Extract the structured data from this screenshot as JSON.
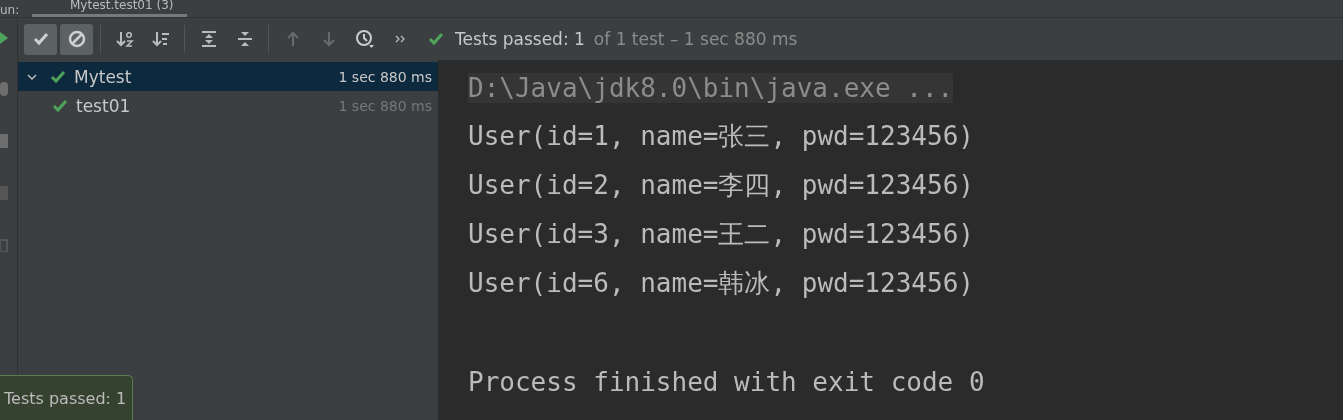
{
  "tabs_bar": {
    "label": "un:",
    "tabs": [
      {
        "label": "Mytest.test01 (3)",
        "selected": true
      }
    ]
  },
  "toolbar": {
    "buttons": [
      {
        "kind": "check",
        "selected": true,
        "disabled": false
      },
      {
        "kind": "ignore",
        "selected": true,
        "disabled": false
      },
      {
        "kind": "sort-alpha",
        "selected": false,
        "disabled": false
      },
      {
        "kind": "sort-duration",
        "selected": false,
        "disabled": false
      },
      {
        "kind": "expand",
        "selected": false,
        "disabled": false
      },
      {
        "kind": "collapse",
        "selected": false,
        "disabled": false
      },
      {
        "kind": "up",
        "selected": false,
        "disabled": true
      },
      {
        "kind": "down",
        "selected": false,
        "disabled": true
      },
      {
        "kind": "history",
        "selected": false,
        "disabled": false
      },
      {
        "kind": "more",
        "selected": false,
        "disabled": false
      }
    ],
    "status": {
      "main": "Tests passed: 1",
      "detail": "of 1 test – 1 sec 880 ms"
    }
  },
  "tree": [
    {
      "name": "Mytest",
      "time": "1 sec 880 ms",
      "expanded": true,
      "selected": true,
      "children": [
        {
          "name": "test01",
          "time": "1 sec 880 ms",
          "selected": false
        }
      ]
    }
  ],
  "console": [
    {
      "kind": "command",
      "text": "D:\\Java\\jdk8.0\\bin\\java.exe ..."
    },
    {
      "kind": "output",
      "text": "User(id=1, name=张三, pwd=123456)"
    },
    {
      "kind": "output",
      "text": "User(id=2, name=李四, pwd=123456)"
    },
    {
      "kind": "output",
      "text": "User(id=3, name=王二, pwd=123456)"
    },
    {
      "kind": "output",
      "text": "User(id=6, name=韩冰, pwd=123456)"
    },
    {
      "kind": "blank"
    },
    {
      "kind": "output",
      "text": "Process finished with exit code 0"
    }
  ],
  "toast": {
    "text": "Tests passed: 1"
  }
}
